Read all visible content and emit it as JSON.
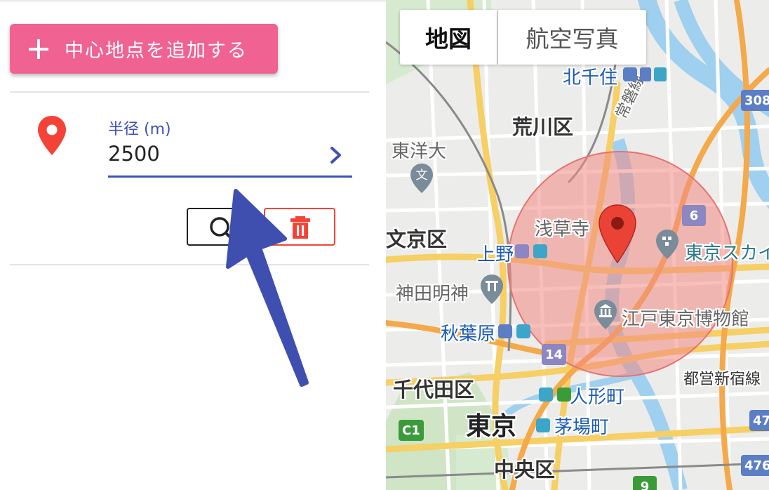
{
  "panel": {
    "add_button_label": "中心地点を追加する",
    "radius_label": "半径 (m)",
    "radius_value": "2500"
  },
  "map": {
    "map_type_options": [
      "地図",
      "航空写真"
    ],
    "selected_map_type": "地図",
    "labels": {
      "kitasenju": "北千住",
      "arakawa": "荒川区",
      "toyo_univ": "東洋大",
      "joban_line": "常磐線",
      "bunkyo": "文京区",
      "asakusa": "浅草寺",
      "ueno": "上野",
      "skytree": "東京スカイ",
      "kanda_myojin": "神田明神",
      "edo_museum": "江戸東京博物館",
      "akihabara": "秋葉原",
      "toei_shinjuku": "都営新宿線",
      "chiyoda": "千代田区",
      "ningyocho": "人形町",
      "tokyo": "東京",
      "kayabacho": "茅場町",
      "chuo": "中央区"
    },
    "route_shields": {
      "r308": "308",
      "r6": "6",
      "r14": "14",
      "c1": "C1",
      "r47": "47",
      "r476": "476",
      "r9": "9"
    },
    "circle_color": "#f28b82",
    "marker_color": "#ea4335"
  },
  "colors": {
    "accent_pink": "#f06292",
    "primary_indigo": "#3f51b5",
    "danger_red": "#f44336"
  }
}
